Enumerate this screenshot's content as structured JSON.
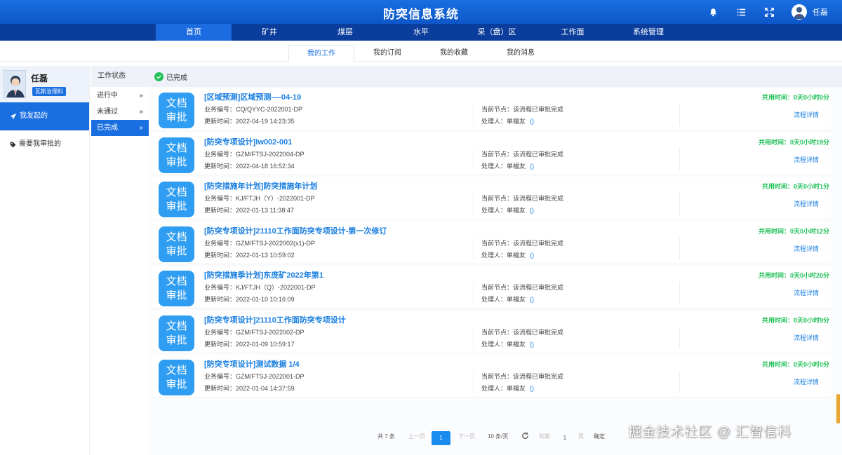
{
  "header": {
    "title": "防突信息系统",
    "user_name": "任磊",
    "icons": [
      "bell-icon",
      "list-icon",
      "fullscreen-icon",
      "user-avatar"
    ]
  },
  "nav": {
    "items": [
      "首页",
      "矿井",
      "煤层",
      "水平",
      "采（盘）区",
      "工作面",
      "系统管理"
    ],
    "active": "首页"
  },
  "subtabs": {
    "items": [
      "我的工作",
      "我的订阅",
      "我的收藏",
      "我的消息"
    ],
    "active": "我的工作"
  },
  "sidebar": {
    "user_name": "任磊",
    "user_dept": "瓦斯治理科",
    "items": [
      {
        "label": "我发起的",
        "icon": "send-icon",
        "active": true
      },
      {
        "label": "需要我审批的",
        "icon": "tag-icon",
        "active": false
      }
    ]
  },
  "status": {
    "heading": "工作状态",
    "items": [
      {
        "label": "进行中",
        "chevron": "»"
      },
      {
        "label": "未通过",
        "chevron": "»"
      },
      {
        "label": "已完成",
        "chevron": "»"
      }
    ],
    "active": "已完成"
  },
  "main": {
    "heading": "已完成",
    "badge_line1": "文档",
    "badge_line2": "审批",
    "link_label": "流程详情",
    "cards": [
      {
        "title": "[区域预测]区域预测----04-19",
        "code": "业务编号：CQ/QYYC-2022001-DP",
        "time": "更新时间：2022-04-19 14:23:35",
        "node": "当前节点：该流程已审批完成",
        "handler": "处理人：单福友",
        "paren": "()",
        "duration": "共用时间：0天0小时0分"
      },
      {
        "title": "[防突专项设计]lw002-001",
        "code": "业务编号：GZM/FTSJ-2022004-DP",
        "time": "更新时间：2022-04-18 16:52:34",
        "node": "当前节点：该流程已审批完成",
        "handler": "处理人：单福友",
        "paren": "()",
        "duration": "共用时间：0天0小时19分"
      },
      {
        "title": "[防突措施年计划]防突措施年计划",
        "code": "业务编号：KJ/FTJH（Y）-2022001-DP",
        "time": "更新时间：2022-01-13 11:38:47",
        "node": "当前节点：该流程已审批完成",
        "handler": "处理人：单福友",
        "paren": "()",
        "duration": "共用时间：0天0小时1分"
      },
      {
        "title": "[防突专项设计]21110工作面防突专项设计-第一次修订",
        "code": "业务编号：GZM/FTSJ-2022002(x1)-DP",
        "time": "更新时间：2022-01-13 10:59:02",
        "node": "当前节点：该流程已审批完成",
        "handler": "处理人：单福友",
        "paren": "()",
        "duration": "共用时间：0天0小时12分"
      },
      {
        "title": "[防突措施季计划]东庞矿2022年第1",
        "code": "业务编号：KJ/FTJH（Q）-2022001-DP",
        "time": "更新时间：2022-01-10 10:16:09",
        "node": "当前节点：该流程已审批完成",
        "handler": "处理人：单福友",
        "paren": "()",
        "duration": "共用时间：0天0小时20分"
      },
      {
        "title": "[防突专项设计]21110工作面防突专项设计",
        "code": "业务编号：GZM/FTSJ-2022002-DP",
        "time": "更新时间：2022-01-09 10:59:17",
        "node": "当前节点：该流程已审批完成",
        "handler": "处理人：单福友",
        "paren": "()",
        "duration": "共用时间：0天0小时9分"
      },
      {
        "title": "[防突专项设计]测试数据 1/4",
        "code": "业务编号：GZM/FTSJ-2022001-DP",
        "time": "更新时间：2022-01-04 14:37:59",
        "node": "当前节点：该流程已审批完成",
        "handler": "处理人：单福友",
        "paren": "()",
        "duration": "共用时间：0天0小时0分"
      }
    ]
  },
  "pager": {
    "total": "共 7 条",
    "prev": "上一页",
    "current": "1",
    "next": "下一页",
    "page_size": "10 条/页",
    "goto_label": "到第",
    "goto_value": "1",
    "page_unit": "页",
    "confirm": "确定"
  },
  "watermark": "掘金技术社区 @ 汇智信科"
}
